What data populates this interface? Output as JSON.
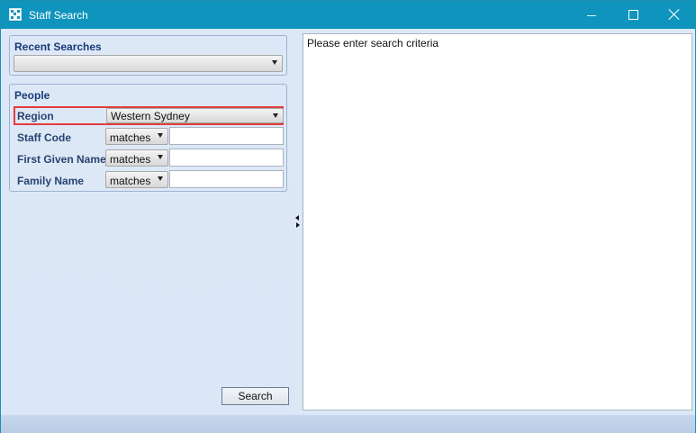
{
  "window": {
    "title": "Staff Search",
    "controls": {
      "minimize_icon": "minimize-icon",
      "maximize_icon": "maximize-icon",
      "close_icon": "close-icon"
    }
  },
  "recent_searches": {
    "heading": "Recent Searches",
    "selected": ""
  },
  "people": {
    "heading": "People",
    "fields": [
      {
        "label": "Region",
        "value": "Western Sydney"
      },
      {
        "label": "Staff Code",
        "operator": "matches",
        "value": ""
      },
      {
        "label": "First Given Name",
        "operator": "matches",
        "value": ""
      },
      {
        "label": "Family Name",
        "operator": "matches",
        "value": ""
      }
    ]
  },
  "actions": {
    "search_label": "Search"
  },
  "results": {
    "message": "Please enter search criteria"
  },
  "colors": {
    "titlebar": "#0f95bd",
    "highlight": "#e23d3d",
    "label": "#27436f"
  }
}
